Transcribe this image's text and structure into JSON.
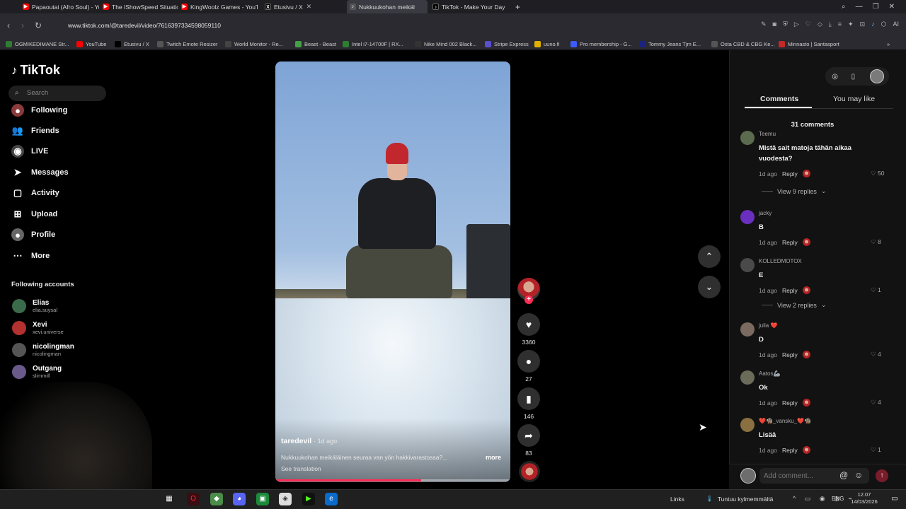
{
  "browser": {
    "tabs": [
      {
        "title": "Papaoutai (Afro Soul) - Yo",
        "icon": "youtube-icon",
        "color": "#ff0000"
      },
      {
        "title": "The IShowSpeed Situation",
        "icon": "youtube-icon",
        "color": "#ff0000"
      },
      {
        "title": "KingWoolz Games - YouT",
        "icon": "youtube-icon",
        "color": "#ff0000"
      },
      {
        "title": "Etusivu / X",
        "icon": "x-icon",
        "color": "#000000"
      },
      {
        "title": "Nukkuukohan meikäl",
        "icon": "tiktok-icon",
        "color": "#444444",
        "active": true
      },
      {
        "title": "TikTok - Make Your Day",
        "icon": "tiktok-icon",
        "color": "#000000"
      }
    ],
    "new_tab": "+",
    "url": "www.tiktok.com/@taredevil/video/7616397334598059110",
    "ai_label": "AI",
    "bookmarks": [
      {
        "label": "OGMIKEDIMANE Str...",
        "color": "#2e7d32"
      },
      {
        "label": "YouTube",
        "color": "#ff0000"
      },
      {
        "label": "Etusivu / X",
        "color": "#000000"
      },
      {
        "label": "Twitch Emote Resizer",
        "color": "#555555"
      },
      {
        "label": "World Monitor - Re...",
        "color": "#444444"
      },
      {
        "label": "Beast - Beast",
        "color": "#43a047"
      },
      {
        "label": "Intel i7-14700F | RX...",
        "color": "#2e7d32"
      },
      {
        "label": "Nike Mind 002 Black...",
        "color": "#333333"
      },
      {
        "label": "Stripe Express",
        "color": "#5a4fcf"
      },
      {
        "label": "uuno.fi",
        "color": "#e0b000"
      },
      {
        "label": "Pro membership - G...",
        "color": "#3d5afe"
      },
      {
        "label": "Tommy Jeans Tjm E...",
        "color": "#1a237e"
      },
      {
        "label": "Osta CBD & CBG Ke...",
        "color": "#555555"
      },
      {
        "label": "Minnasto | Santasport",
        "color": "#c62828"
      }
    ]
  },
  "sidebar": {
    "logo": "TikTok",
    "search_placeholder": "Search",
    "items": [
      {
        "label": "Following",
        "icon": "following-icon"
      },
      {
        "label": "Friends",
        "icon": "friends-icon"
      },
      {
        "label": "LIVE",
        "icon": "live-icon"
      },
      {
        "label": "Messages",
        "icon": "messages-icon"
      },
      {
        "label": "Activity",
        "icon": "activity-icon"
      },
      {
        "label": "Upload",
        "icon": "upload-icon"
      },
      {
        "label": "Profile",
        "icon": "profile-icon"
      },
      {
        "label": "More",
        "icon": "more-icon"
      }
    ],
    "following_title": "Following accounts",
    "accounts": [
      {
        "name": "Elias",
        "handle": "elia.suysal",
        "color": "#3a6b4a"
      },
      {
        "name": "Xevi",
        "handle": "xevi.universe",
        "color": "#b3322f"
      },
      {
        "name": "nicolingman",
        "handle": "nicolingman",
        "color": "#555555"
      },
      {
        "name": "Outgang",
        "handle": "slimmill",
        "color": "#6a5a8c"
      }
    ]
  },
  "video": {
    "author": "taredevil",
    "posted": "· 1d ago",
    "caption": "Nukkuukohan meikäläinen seuraa van yön hakkivarastossa?...",
    "more": "more",
    "see_translation": "See translation",
    "progress_fraction": 0.62
  },
  "actions": {
    "likes": "3360",
    "comments": "27",
    "saves": "146",
    "shares": "83",
    "follow_plus": "+"
  },
  "panel": {
    "tabs": [
      "Comments",
      "You may like"
    ],
    "comment_count": "31 comments",
    "comments": [
      {
        "user": "Teemu",
        "text": "Mistä sait matoja tähän aikaa vuodesta?",
        "time": "1d ago",
        "reply": "Reply",
        "likes": "50",
        "view_replies": "View 9 replies",
        "avatar": "#5b6b4e"
      },
      {
        "user": "jacky",
        "text": "B",
        "time": "1d ago",
        "reply": "Reply",
        "likes": "8",
        "avatar": "#6a2fbf"
      },
      {
        "user": "KOLLEDMOTOX",
        "text": "E",
        "time": "1d ago",
        "reply": "Reply",
        "likes": "1",
        "view_replies": "View 2 replies",
        "avatar": "#4a4a4a"
      },
      {
        "user": "julia ❤️",
        "text": "D",
        "time": "1d ago",
        "reply": "Reply",
        "likes": "4",
        "avatar": "#7a6a60"
      },
      {
        "user": "Aatos🦾",
        "text": "Ok",
        "time": "1d ago",
        "reply": "Reply",
        "likes": "4",
        "avatar": "#6b6b5a"
      },
      {
        "user": "❤️🧌_vansku_❤️🧌",
        "text": "Lisää",
        "time": "1d ago",
        "reply": "Reply",
        "likes": "1",
        "avatar": "#8a7040"
      }
    ],
    "add_comment_placeholder": "Add comment...",
    "at_symbol": "@",
    "emoji_symbol": "☺"
  },
  "taskbar": {
    "links": "Links",
    "weather": "Tuntuu kylmemmältä",
    "lang": "ENG",
    "time": "12.07",
    "date": "14/03/2026"
  }
}
